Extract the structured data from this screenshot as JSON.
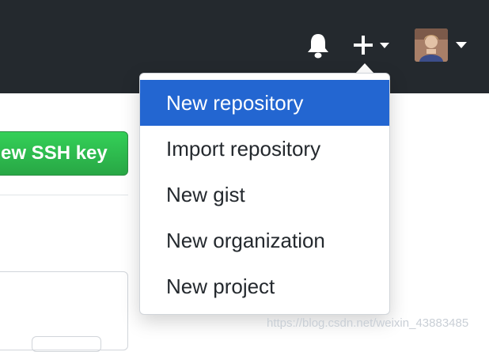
{
  "header": {
    "notifications_icon": "bell-icon",
    "create_icon": "plus-icon",
    "caret_icon": "caret-down-icon",
    "colors": {
      "background": "#24292e",
      "icon": "#ffffff"
    }
  },
  "page": {
    "ssh_button_label": "ew SSH key",
    "colors": {
      "button": "#28a745"
    }
  },
  "dropdown": {
    "items": [
      {
        "label": "New repository",
        "active": true
      },
      {
        "label": "Import repository",
        "active": false
      },
      {
        "label": "New gist",
        "active": false
      },
      {
        "label": "New organization",
        "active": false
      },
      {
        "label": "New project",
        "active": false
      }
    ],
    "colors": {
      "active_background": "#2366d1",
      "text": "#24292e"
    }
  },
  "watermark": "https://blog.csdn.net/weixin_43883485"
}
